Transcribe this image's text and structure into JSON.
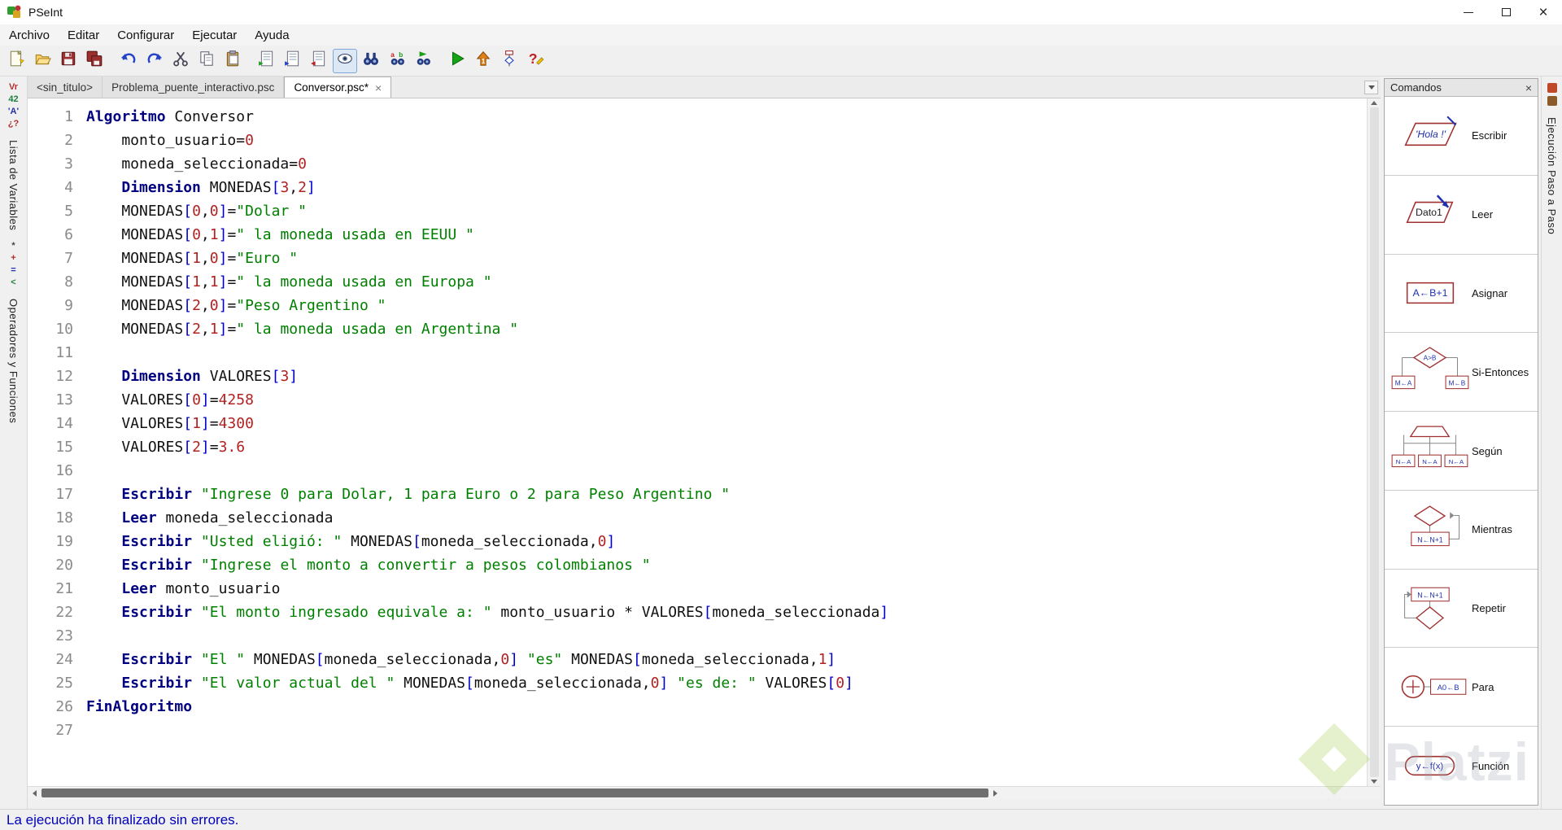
{
  "window": {
    "title": "PSeInt"
  },
  "menu": {
    "items": [
      "Archivo",
      "Editar",
      "Configurar",
      "Ejecutar",
      "Ayuda"
    ]
  },
  "toolbar": {
    "items": [
      {
        "type": "button",
        "name": "new-file"
      },
      {
        "type": "button",
        "name": "open-file"
      },
      {
        "type": "button",
        "name": "save-file"
      },
      {
        "type": "button",
        "name": "save-all"
      },
      {
        "type": "sep"
      },
      {
        "type": "button",
        "name": "undo"
      },
      {
        "type": "button",
        "name": "redo"
      },
      {
        "type": "button",
        "name": "cut"
      },
      {
        "type": "button",
        "name": "copy"
      },
      {
        "type": "button",
        "name": "paste"
      },
      {
        "type": "sep"
      },
      {
        "type": "button",
        "name": "indent-doc"
      },
      {
        "type": "button",
        "name": "comment-doc"
      },
      {
        "type": "button",
        "name": "uncomment-doc"
      },
      {
        "type": "button",
        "name": "syntax-check",
        "pressed": true
      },
      {
        "type": "button",
        "name": "find"
      },
      {
        "type": "button",
        "name": "find-replace"
      },
      {
        "type": "button",
        "name": "find-next"
      },
      {
        "type": "sep"
      },
      {
        "type": "button",
        "name": "run"
      },
      {
        "type": "button",
        "name": "run-step"
      },
      {
        "type": "button",
        "name": "draw-flowchart"
      },
      {
        "type": "button",
        "name": "help-quick"
      }
    ]
  },
  "tabs": {
    "items": [
      {
        "label": "<sin_titulo>",
        "active": false
      },
      {
        "label": "Problema_puente_interactivo.psc",
        "active": false
      },
      {
        "label": "Conversor.psc*",
        "active": true,
        "close": "×"
      }
    ]
  },
  "left_sidebar": {
    "sections": [
      {
        "icons": [
          {
            "glyph": "Vr",
            "color": "#b03030"
          },
          {
            "glyph": "42",
            "color": "#208040"
          },
          {
            "glyph": "'A'",
            "color": "#2030b0"
          },
          {
            "glyph": "¿?",
            "color": "#b03030"
          }
        ],
        "label": "Lista de Variables"
      },
      {
        "icons": [
          {
            "glyph": "*",
            "color": "#444444"
          },
          {
            "glyph": "+",
            "color": "#b03030"
          },
          {
            "glyph": "=",
            "color": "#2030b0"
          },
          {
            "glyph": "<",
            "color": "#208040"
          }
        ],
        "label": "Operadores y Funciones"
      }
    ]
  },
  "right_sidebar": {
    "label": "Ejecución Paso a Paso"
  },
  "editor": {
    "lines": [
      {
        "num": "1",
        "tokens": [
          {
            "t": "kw",
            "v": "Algoritmo"
          },
          {
            "t": "pl",
            "v": " Conversor"
          }
        ]
      },
      {
        "num": "2",
        "tokens": [
          {
            "t": "pl",
            "v": "    monto_usuario="
          },
          {
            "t": "num",
            "v": "0"
          }
        ]
      },
      {
        "num": "3",
        "tokens": [
          {
            "t": "pl",
            "v": "    moneda_seleccionada="
          },
          {
            "t": "num",
            "v": "0"
          }
        ]
      },
      {
        "num": "4",
        "tokens": [
          {
            "t": "pl",
            "v": "    "
          },
          {
            "t": "kw",
            "v": "Dimension"
          },
          {
            "t": "pl",
            "v": " MONEDAS"
          },
          {
            "t": "br",
            "v": "["
          },
          {
            "t": "num",
            "v": "3"
          },
          {
            "t": "pl",
            "v": ","
          },
          {
            "t": "num",
            "v": "2"
          },
          {
            "t": "br",
            "v": "]"
          }
        ]
      },
      {
        "num": "5",
        "tokens": [
          {
            "t": "pl",
            "v": "    MONEDAS"
          },
          {
            "t": "br",
            "v": "["
          },
          {
            "t": "num",
            "v": "0"
          },
          {
            "t": "pl",
            "v": ","
          },
          {
            "t": "num",
            "v": "0"
          },
          {
            "t": "br",
            "v": "]"
          },
          {
            "t": "pl",
            "v": "="
          },
          {
            "t": "str",
            "v": "\"Dolar \""
          }
        ]
      },
      {
        "num": "6",
        "tokens": [
          {
            "t": "pl",
            "v": "    MONEDAS"
          },
          {
            "t": "br",
            "v": "["
          },
          {
            "t": "num",
            "v": "0"
          },
          {
            "t": "pl",
            "v": ","
          },
          {
            "t": "num",
            "v": "1"
          },
          {
            "t": "br",
            "v": "]"
          },
          {
            "t": "pl",
            "v": "="
          },
          {
            "t": "str",
            "v": "\" la moneda usada en EEUU \""
          }
        ]
      },
      {
        "num": "7",
        "tokens": [
          {
            "t": "pl",
            "v": "    MONEDAS"
          },
          {
            "t": "br",
            "v": "["
          },
          {
            "t": "num",
            "v": "1"
          },
          {
            "t": "pl",
            "v": ","
          },
          {
            "t": "num",
            "v": "0"
          },
          {
            "t": "br",
            "v": "]"
          },
          {
            "t": "pl",
            "v": "="
          },
          {
            "t": "str",
            "v": "\"Euro \""
          }
        ]
      },
      {
        "num": "8",
        "tokens": [
          {
            "t": "pl",
            "v": "    MONEDAS"
          },
          {
            "t": "br",
            "v": "["
          },
          {
            "t": "num",
            "v": "1"
          },
          {
            "t": "pl",
            "v": ","
          },
          {
            "t": "num",
            "v": "1"
          },
          {
            "t": "br",
            "v": "]"
          },
          {
            "t": "pl",
            "v": "="
          },
          {
            "t": "str",
            "v": "\" la moneda usada en Europa \""
          }
        ]
      },
      {
        "num": "9",
        "tokens": [
          {
            "t": "pl",
            "v": "    MONEDAS"
          },
          {
            "t": "br",
            "v": "["
          },
          {
            "t": "num",
            "v": "2"
          },
          {
            "t": "pl",
            "v": ","
          },
          {
            "t": "num",
            "v": "0"
          },
          {
            "t": "br",
            "v": "]"
          },
          {
            "t": "pl",
            "v": "="
          },
          {
            "t": "str",
            "v": "\"Peso Argentino \""
          }
        ]
      },
      {
        "num": "10",
        "tokens": [
          {
            "t": "pl",
            "v": "    MONEDAS"
          },
          {
            "t": "br",
            "v": "["
          },
          {
            "t": "num",
            "v": "2"
          },
          {
            "t": "pl",
            "v": ","
          },
          {
            "t": "num",
            "v": "1"
          },
          {
            "t": "br",
            "v": "]"
          },
          {
            "t": "pl",
            "v": "="
          },
          {
            "t": "str",
            "v": "\" la moneda usada en Argentina \""
          }
        ]
      },
      {
        "num": "11",
        "tokens": []
      },
      {
        "num": "12",
        "tokens": [
          {
            "t": "pl",
            "v": "    "
          },
          {
            "t": "kw",
            "v": "Dimension"
          },
          {
            "t": "pl",
            "v": " VALORES"
          },
          {
            "t": "br",
            "v": "["
          },
          {
            "t": "num",
            "v": "3"
          },
          {
            "t": "br",
            "v": "]"
          }
        ]
      },
      {
        "num": "13",
        "tokens": [
          {
            "t": "pl",
            "v": "    VALORES"
          },
          {
            "t": "br",
            "v": "["
          },
          {
            "t": "num",
            "v": "0"
          },
          {
            "t": "br",
            "v": "]"
          },
          {
            "t": "pl",
            "v": "="
          },
          {
            "t": "num",
            "v": "4258"
          }
        ]
      },
      {
        "num": "14",
        "tokens": [
          {
            "t": "pl",
            "v": "    VALORES"
          },
          {
            "t": "br",
            "v": "["
          },
          {
            "t": "num",
            "v": "1"
          },
          {
            "t": "br",
            "v": "]"
          },
          {
            "t": "pl",
            "v": "="
          },
          {
            "t": "num",
            "v": "4300"
          }
        ]
      },
      {
        "num": "15",
        "tokens": [
          {
            "t": "pl",
            "v": "    VALORES"
          },
          {
            "t": "br",
            "v": "["
          },
          {
            "t": "num",
            "v": "2"
          },
          {
            "t": "br",
            "v": "]"
          },
          {
            "t": "pl",
            "v": "="
          },
          {
            "t": "num",
            "v": "3.6"
          }
        ]
      },
      {
        "num": "16",
        "tokens": []
      },
      {
        "num": "17",
        "tokens": [
          {
            "t": "pl",
            "v": "    "
          },
          {
            "t": "kw",
            "v": "Escribir"
          },
          {
            "t": "pl",
            "v": " "
          },
          {
            "t": "str",
            "v": "\"Ingrese 0 para Dolar, 1 para Euro o 2 para Peso Argentino \""
          }
        ]
      },
      {
        "num": "18",
        "tokens": [
          {
            "t": "pl",
            "v": "    "
          },
          {
            "t": "kw",
            "v": "Leer"
          },
          {
            "t": "pl",
            "v": " moneda_seleccionada"
          }
        ]
      },
      {
        "num": "19",
        "tokens": [
          {
            "t": "pl",
            "v": "    "
          },
          {
            "t": "kw",
            "v": "Escribir"
          },
          {
            "t": "pl",
            "v": " "
          },
          {
            "t": "str",
            "v": "\"Usted eligió: \""
          },
          {
            "t": "pl",
            "v": " MONEDAS"
          },
          {
            "t": "br",
            "v": "["
          },
          {
            "t": "pl",
            "v": "moneda_seleccionada,"
          },
          {
            "t": "num",
            "v": "0"
          },
          {
            "t": "br",
            "v": "]"
          }
        ]
      },
      {
        "num": "20",
        "tokens": [
          {
            "t": "pl",
            "v": "    "
          },
          {
            "t": "kw",
            "v": "Escribir"
          },
          {
            "t": "pl",
            "v": " "
          },
          {
            "t": "str",
            "v": "\"Ingrese el monto a convertir a pesos colombianos \""
          }
        ]
      },
      {
        "num": "21",
        "tokens": [
          {
            "t": "pl",
            "v": "    "
          },
          {
            "t": "kw",
            "v": "Leer"
          },
          {
            "t": "pl",
            "v": " monto_usuario"
          }
        ]
      },
      {
        "num": "22",
        "tokens": [
          {
            "t": "pl",
            "v": "    "
          },
          {
            "t": "kw",
            "v": "Escribir"
          },
          {
            "t": "pl",
            "v": " "
          },
          {
            "t": "str",
            "v": "\"El monto ingresado equivale a: \""
          },
          {
            "t": "pl",
            "v": " monto_usuario * VALORES"
          },
          {
            "t": "br",
            "v": "["
          },
          {
            "t": "pl",
            "v": "moneda_seleccionada"
          },
          {
            "t": "br",
            "v": "]"
          }
        ]
      },
      {
        "num": "23",
        "tokens": []
      },
      {
        "num": "24",
        "tokens": [
          {
            "t": "pl",
            "v": "    "
          },
          {
            "t": "kw",
            "v": "Escribir"
          },
          {
            "t": "pl",
            "v": " "
          },
          {
            "t": "str",
            "v": "\"El \""
          },
          {
            "t": "pl",
            "v": " MONEDAS"
          },
          {
            "t": "br",
            "v": "["
          },
          {
            "t": "pl",
            "v": "moneda_seleccionada,"
          },
          {
            "t": "num",
            "v": "0"
          },
          {
            "t": "br",
            "v": "]"
          },
          {
            "t": "pl",
            "v": " "
          },
          {
            "t": "str",
            "v": "\"es\""
          },
          {
            "t": "pl",
            "v": " MONEDAS"
          },
          {
            "t": "br",
            "v": "["
          },
          {
            "t": "pl",
            "v": "moneda_seleccionada,"
          },
          {
            "t": "num",
            "v": "1"
          },
          {
            "t": "br",
            "v": "]"
          }
        ]
      },
      {
        "num": "25",
        "tokens": [
          {
            "t": "pl",
            "v": "    "
          },
          {
            "t": "kw",
            "v": "Escribir"
          },
          {
            "t": "pl",
            "v": " "
          },
          {
            "t": "str",
            "v": "\"El valor actual del \""
          },
          {
            "t": "pl",
            "v": " MONEDAS"
          },
          {
            "t": "br",
            "v": "["
          },
          {
            "t": "pl",
            "v": "moneda_seleccionada,"
          },
          {
            "t": "num",
            "v": "0"
          },
          {
            "t": "br",
            "v": "]"
          },
          {
            "t": "pl",
            "v": " "
          },
          {
            "t": "str",
            "v": "\"es de: \""
          },
          {
            "t": "pl",
            "v": " VALORES"
          },
          {
            "t": "br",
            "v": "["
          },
          {
            "t": "num",
            "v": "0"
          },
          {
            "t": "br",
            "v": "]"
          }
        ]
      },
      {
        "num": "26",
        "tokens": [
          {
            "t": "kw",
            "v": "FinAlgoritmo"
          }
        ]
      },
      {
        "num": "27",
        "tokens": []
      }
    ]
  },
  "commands": {
    "title": "Comandos",
    "close": "×",
    "items": [
      {
        "label": "Escribir",
        "icon": "cmd-escribir",
        "icon_text": "'Hola !'",
        "subs": []
      },
      {
        "label": "Leer",
        "icon": "cmd-leer",
        "icon_text": "Dato1",
        "subs": []
      },
      {
        "label": "Asignar",
        "icon": "cmd-asignar",
        "icon_text": "A←B+1",
        "subs": []
      },
      {
        "label": "Si-Entonces",
        "icon": "cmd-si",
        "icon_text": "A>B",
        "subs": [
          "M←A",
          "M←B"
        ]
      },
      {
        "label": "Según",
        "icon": "cmd-segun",
        "icon_text": "",
        "subs": [
          "N←A",
          "N←A",
          "N←A"
        ]
      },
      {
        "label": "Mientras",
        "icon": "cmd-mientras",
        "icon_text": "",
        "subs": [
          "N←N+1"
        ]
      },
      {
        "label": "Repetir",
        "icon": "cmd-repetir",
        "icon_text": "",
        "subs": [
          "N←N+1"
        ]
      },
      {
        "label": "Para",
        "icon": "cmd-para",
        "icon_text": "",
        "subs": [
          "A0←B"
        ]
      },
      {
        "label": "Función",
        "icon": "cmd-funcion",
        "icon_text": "y←f(x)",
        "subs": []
      }
    ]
  },
  "status_bar": {
    "text": "La ejecución ha finalizado sin errores."
  },
  "watermark": {
    "text": "Platzi"
  },
  "colors": {
    "keyword": "#000080",
    "string": "#008000",
    "number": "#b22222",
    "bracket": "#0000cc",
    "status_text": "#0000bb",
    "platzi_green": "#98ca3f"
  }
}
